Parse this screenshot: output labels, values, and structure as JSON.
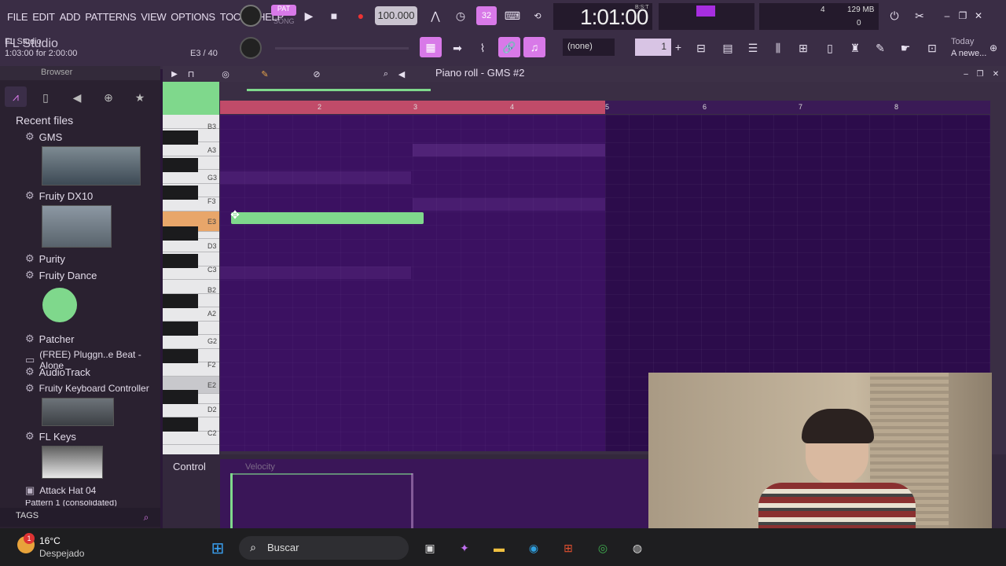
{
  "menu": {
    "items": [
      "FILE",
      "EDIT",
      "ADD",
      "PATTERNS",
      "VIEW",
      "OPTIONS",
      "TOOLS",
      "HELP"
    ]
  },
  "transport": {
    "pat_label": "PAT",
    "song_label": "SONG",
    "tempo": "100.000",
    "time": "1:01:00",
    "time_unit": "B:S:T",
    "cpu_count": "4",
    "memory": "129 MB",
    "voices": "0"
  },
  "hint_bar": {
    "app": "FL Studio",
    "position": "1:03:00 for 2:00:00",
    "note": "E3 / 40"
  },
  "toolbar2": {
    "preset": "(none)",
    "step": "1"
  },
  "news": {
    "line1": "Today",
    "line2": "A newe..."
  },
  "browser": {
    "title": "Browser",
    "section": "Recent files",
    "items": [
      "GMS",
      "Fruity DX10",
      "Purity",
      "Fruity Dance",
      "Patcher",
      "(FREE) Pluggn..e Beat - Alone",
      "AudioTrack",
      "Fruity Keyboard Controller",
      "FL Keys",
      "Attack Hat 04",
      "Pattern 1 (consolidated)"
    ],
    "tags_label": "TAGS"
  },
  "pianoroll": {
    "title": "Piano roll - GMS #2",
    "bar_numbers": [
      "2",
      "3",
      "4",
      "5",
      "6",
      "7",
      "8"
    ],
    "keys": [
      "B3",
      "A3",
      "G3",
      "F3",
      "E3",
      "D3",
      "C3",
      "B2",
      "A2",
      "G2",
      "F2",
      "E2",
      "D2",
      "C2"
    ],
    "control_label": "Control",
    "velocity_label": "Velocity",
    "note": {
      "pitch": "E3",
      "start_bar": 1,
      "end_bar": 3.1
    }
  },
  "taskbar": {
    "temp": "16°C",
    "weather": "Despejado",
    "search_placeholder": "Buscar",
    "notification_count": "1"
  },
  "colors": {
    "accent": "#d879e8",
    "note": "#7fd88c",
    "grid": "#2c0c4b",
    "loop": "#c04b69"
  }
}
